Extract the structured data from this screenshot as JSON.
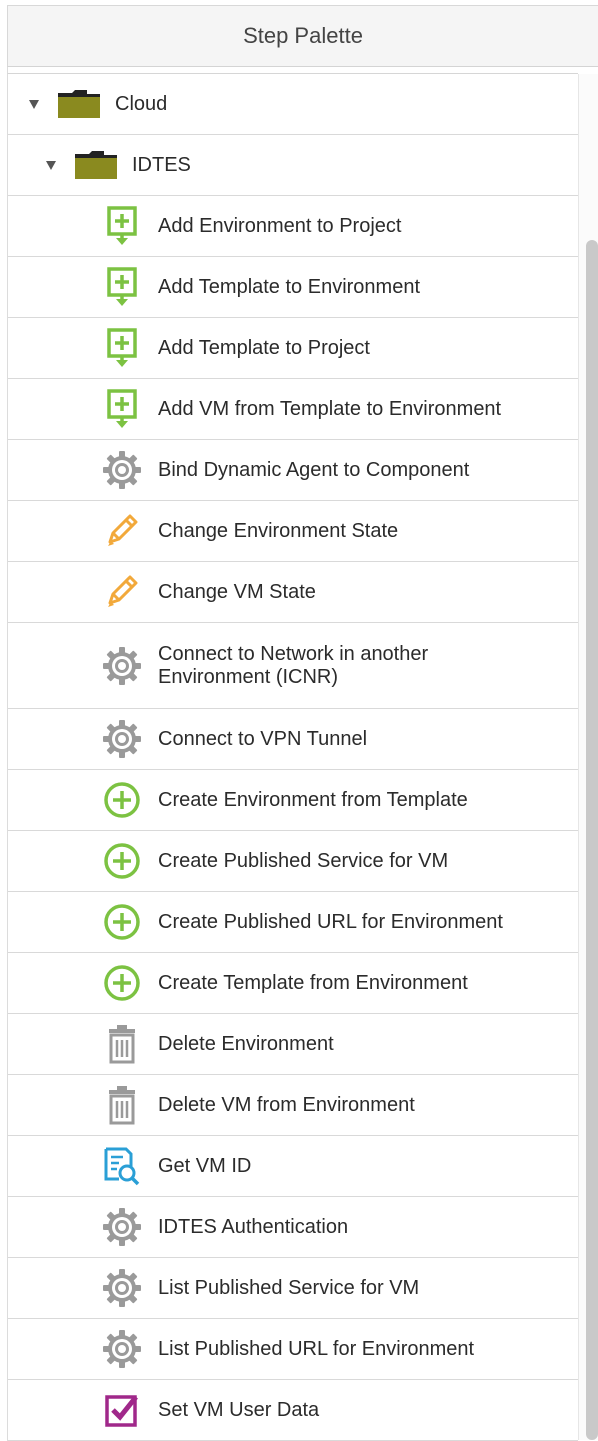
{
  "panel": {
    "title": "Step Palette"
  },
  "tree": {
    "root": {
      "label": "Cloud",
      "icon": "folder-icon",
      "expanded": true
    },
    "child": {
      "label": "IDTES",
      "icon": "folder-icon",
      "expanded": true
    },
    "steps": [
      {
        "label": "Add Environment to Project",
        "icon": "add-to-icon"
      },
      {
        "label": "Add Template to Environment",
        "icon": "add-to-icon"
      },
      {
        "label": "Add Template to Project",
        "icon": "add-to-icon"
      },
      {
        "label": "Add VM from Template to Environment",
        "icon": "add-to-icon"
      },
      {
        "label": "Bind Dynamic Agent to Component",
        "icon": "gear-icon"
      },
      {
        "label": "Change Environment State",
        "icon": "pencil-icon"
      },
      {
        "label": "Change VM State",
        "icon": "pencil-icon"
      },
      {
        "label": "Connect to Network in another",
        "label2": "Environment (ICNR)",
        "icon": "gear-icon"
      },
      {
        "label": "Connect to VPN Tunnel",
        "icon": "gear-icon"
      },
      {
        "label": "Create Environment from Template",
        "icon": "plus-circle-icon"
      },
      {
        "label": "Create Published Service for VM",
        "icon": "plus-circle-icon"
      },
      {
        "label": "Create Published URL for Environment",
        "icon": "plus-circle-icon"
      },
      {
        "label": "Create Template from Environment",
        "icon": "plus-circle-icon"
      },
      {
        "label": "Delete Environment",
        "icon": "trash-icon"
      },
      {
        "label": "Delete VM from Environment",
        "icon": "trash-icon"
      },
      {
        "label": "Get VM ID",
        "icon": "document-search-icon"
      },
      {
        "label": "IDTES Authentication",
        "icon": "gear-icon"
      },
      {
        "label": "List Published Service for VM",
        "icon": "gear-icon"
      },
      {
        "label": "List Published URL for Environment",
        "icon": "gear-icon"
      },
      {
        "label": "Set VM User Data",
        "icon": "checkbox-icon"
      }
    ]
  },
  "colors": {
    "folder": "#8a8a1f",
    "add": "#7cc242",
    "gear": "#9a9a9a",
    "pencil": "#f2a93b",
    "trash": "#9a9a9a",
    "search": "#2a9fd6",
    "checkbox": "#a0288a"
  }
}
